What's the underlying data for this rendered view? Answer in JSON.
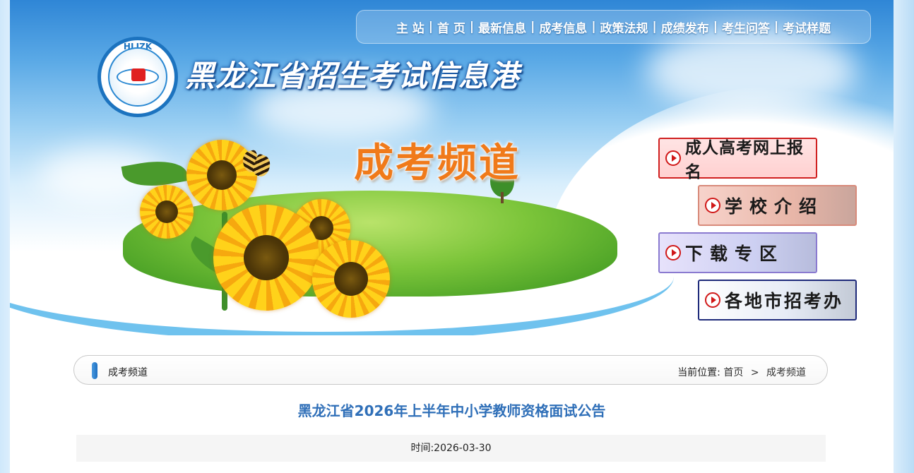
{
  "nav": {
    "items": [
      "主 站",
      "首 页",
      "最新信息",
      "成考信息",
      "政策法规",
      "成绩发布",
      "考生问答",
      "考试样题"
    ],
    "separator": "|"
  },
  "logo": {
    "text": "HLJZK"
  },
  "header": {
    "site_title": "黑龙江省招生考试信息港",
    "channel_title": "成考频道"
  },
  "side_buttons": [
    {
      "label": "成人高考网上报名"
    },
    {
      "label": "学校介绍"
    },
    {
      "label": "下载专区"
    },
    {
      "label": "各地市招考办"
    }
  ],
  "breadcrumb": {
    "section": "成考频道",
    "location_label": "当前位置:",
    "home": "首页",
    "arrow": ">",
    "current": "成考频道"
  },
  "article": {
    "title": "黑龙江省2026年上半年中小学教师资格面试公告",
    "time_label": "时间:",
    "date": "2026-03-30"
  },
  "colors": {
    "nav_text": "#ffffff",
    "channel_title": "#f07a1a",
    "article_title": "#2f6fb8",
    "play_icon": "#d01818"
  }
}
